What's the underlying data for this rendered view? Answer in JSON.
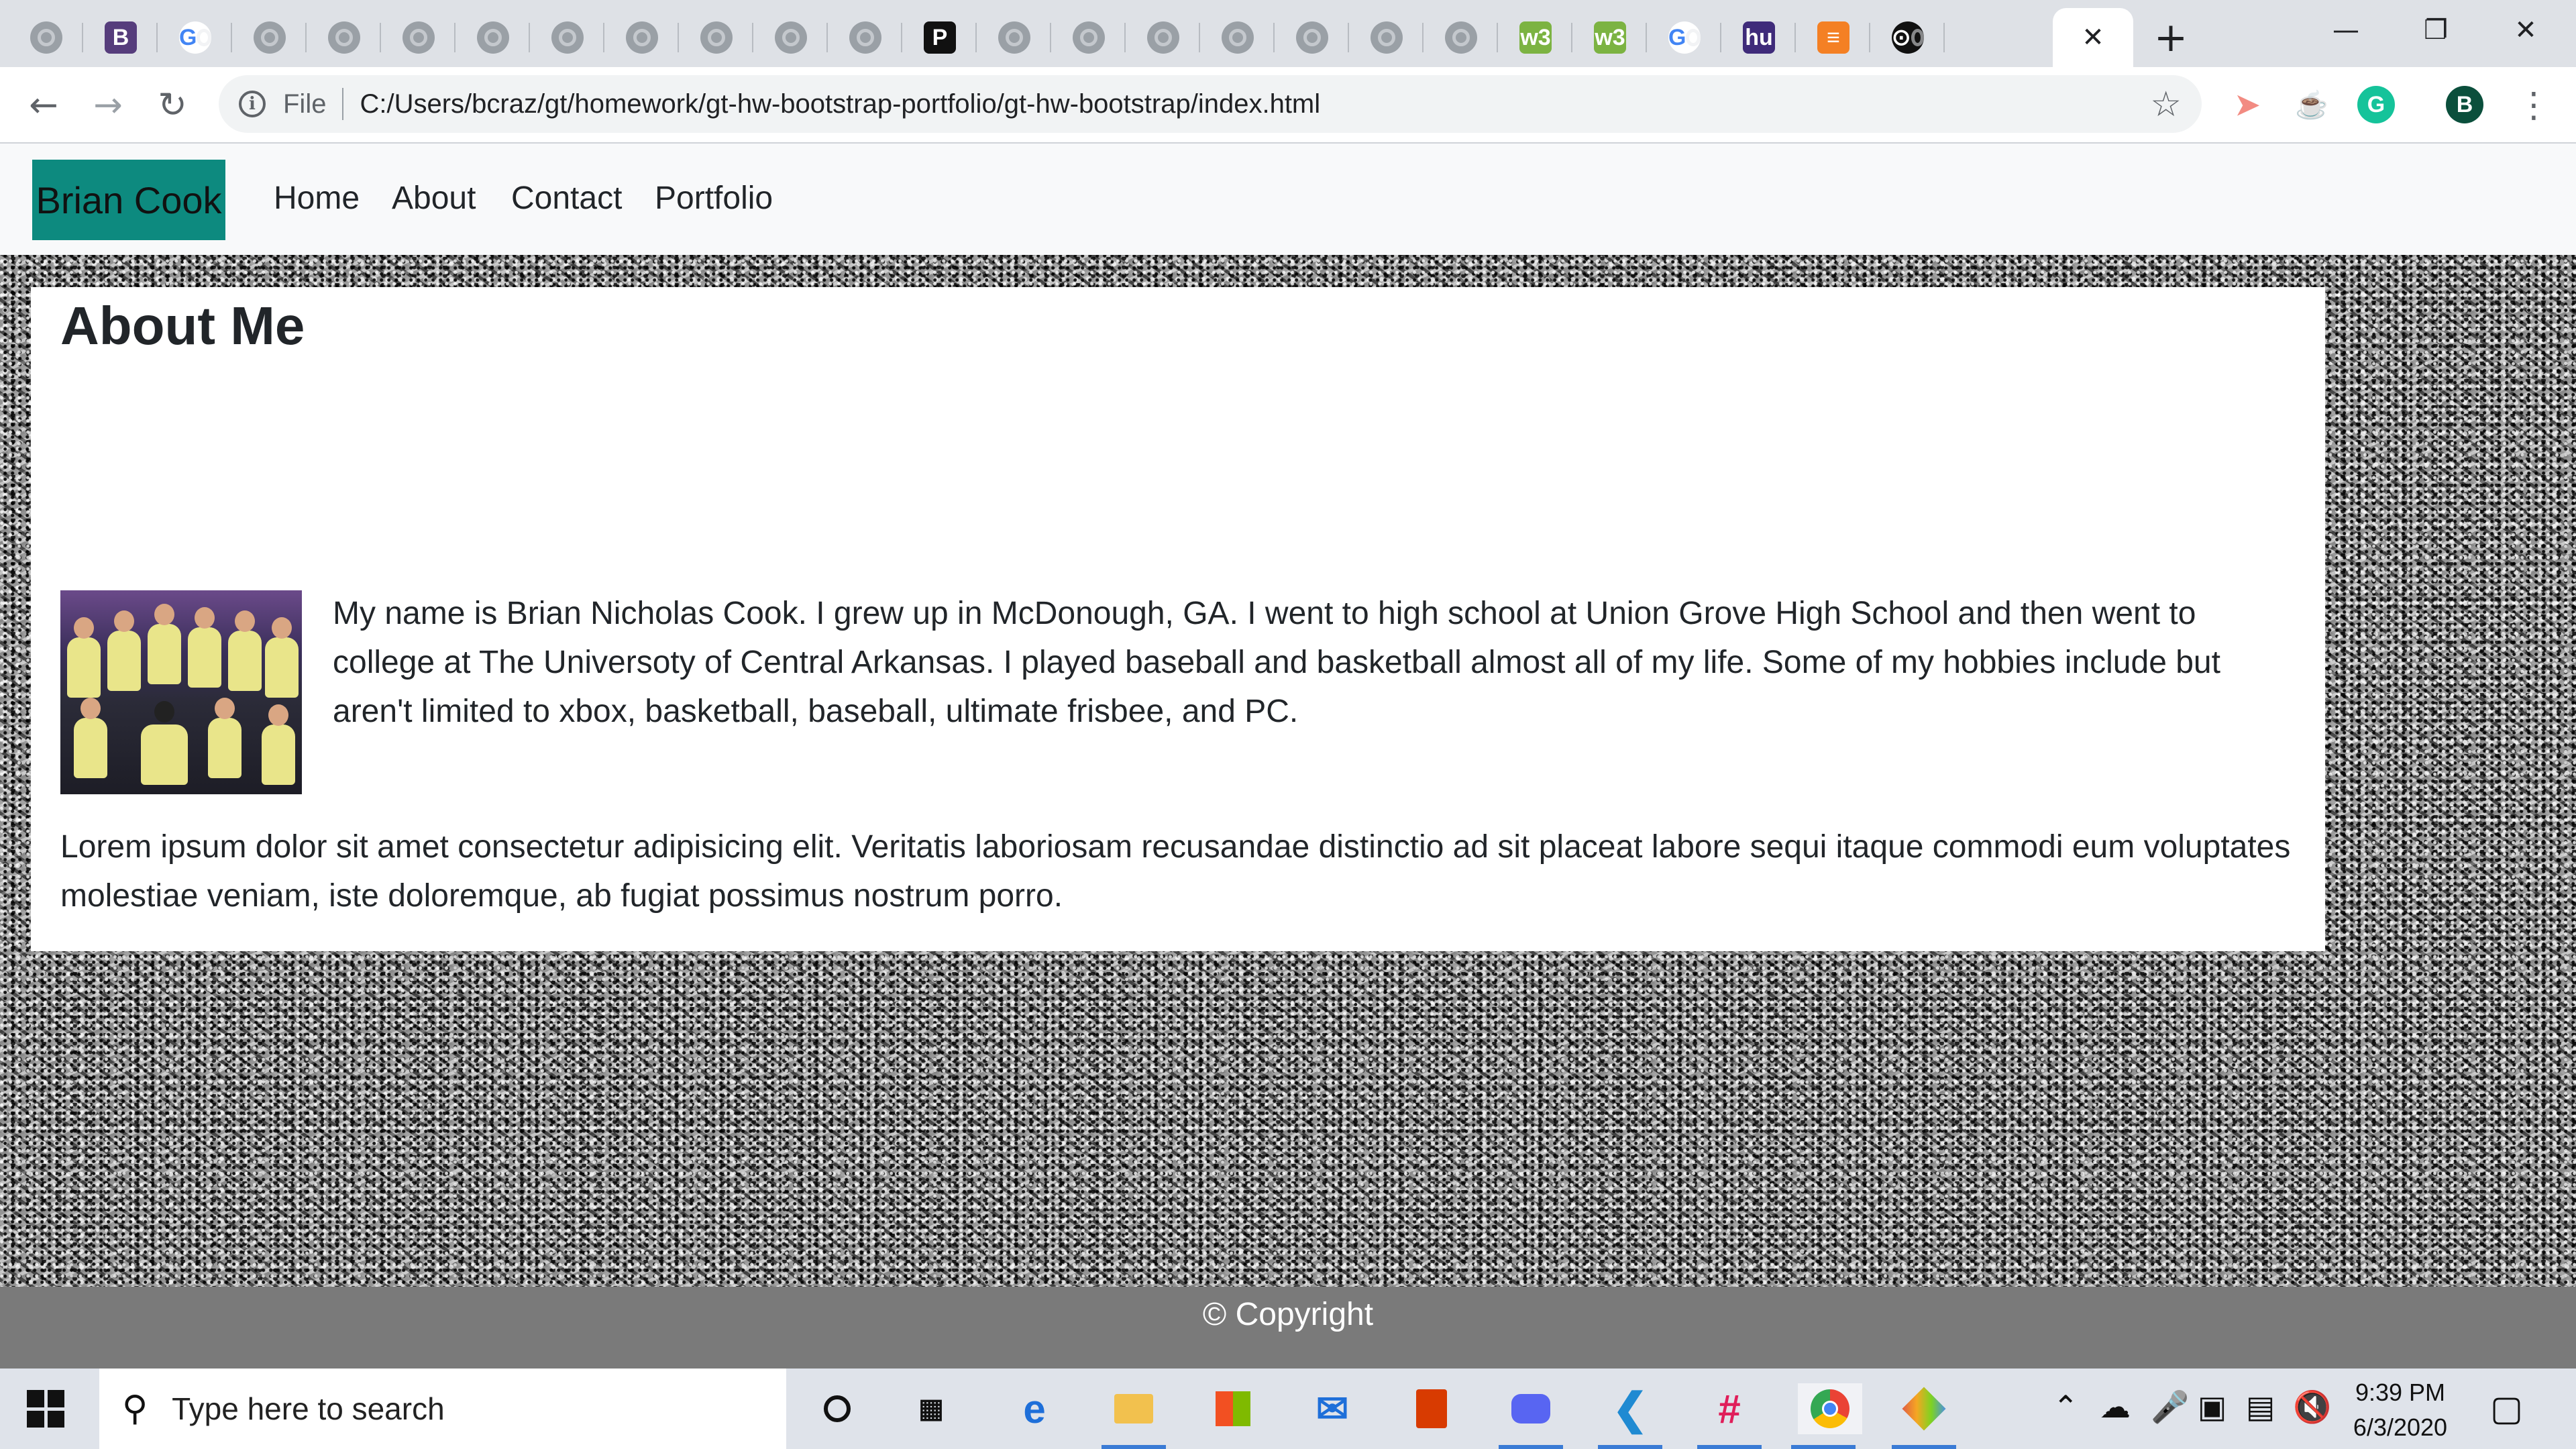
{
  "browser": {
    "tabs_count": 27,
    "active_tab_close": "✕",
    "new_tab": "+",
    "window": {
      "minimize": "—",
      "restore": "❐",
      "close": "✕"
    },
    "omnibox": {
      "scheme_label": "File",
      "url": "C:/Users/bcraz/gt/homework/gt-hw-bootstrap-portfolio/gt-hw-bootstrap/index.html"
    },
    "profile_initial": "B",
    "colors": {
      "tabstrip": "#dee1e6",
      "toolbar": "#ffffff",
      "omnibox": "#f1f3f4"
    }
  },
  "site": {
    "brand": "Brian Cook",
    "nav": [
      "Home",
      "About",
      "Contact",
      "Portfolio"
    ],
    "heading": "About Me",
    "bio": "My name is Brian Nicholas Cook. I grew up in McDonough, GA. I went to high school at Union Grove High School and then went to college at The Universoty of Central Arkansas. I played baseball and basketball almost all of my life. Some of my hobbies include but aren't limited to xbox, basketball, baseball, ultimate frisbee, and PC.",
    "lorem": "Lorem ipsum dolor sit amet consectetur adipisicing elit. Veritatis laboriosam recusandae distinctio ad sit placeat labore sequi itaque commodi eum voluptates molestiae veniam, iste doloremque, ab fugiat possimus nostrum porro.",
    "footer": "© Copyright",
    "colors": {
      "brand_bg": "#0d8a7f",
      "navbar_bg": "#f8f9fa",
      "footer_bg": "#7a7a7a"
    }
  },
  "taskbar": {
    "search_placeholder": "Type here to search",
    "time": "9:39 PM",
    "date": "6/3/2020"
  }
}
